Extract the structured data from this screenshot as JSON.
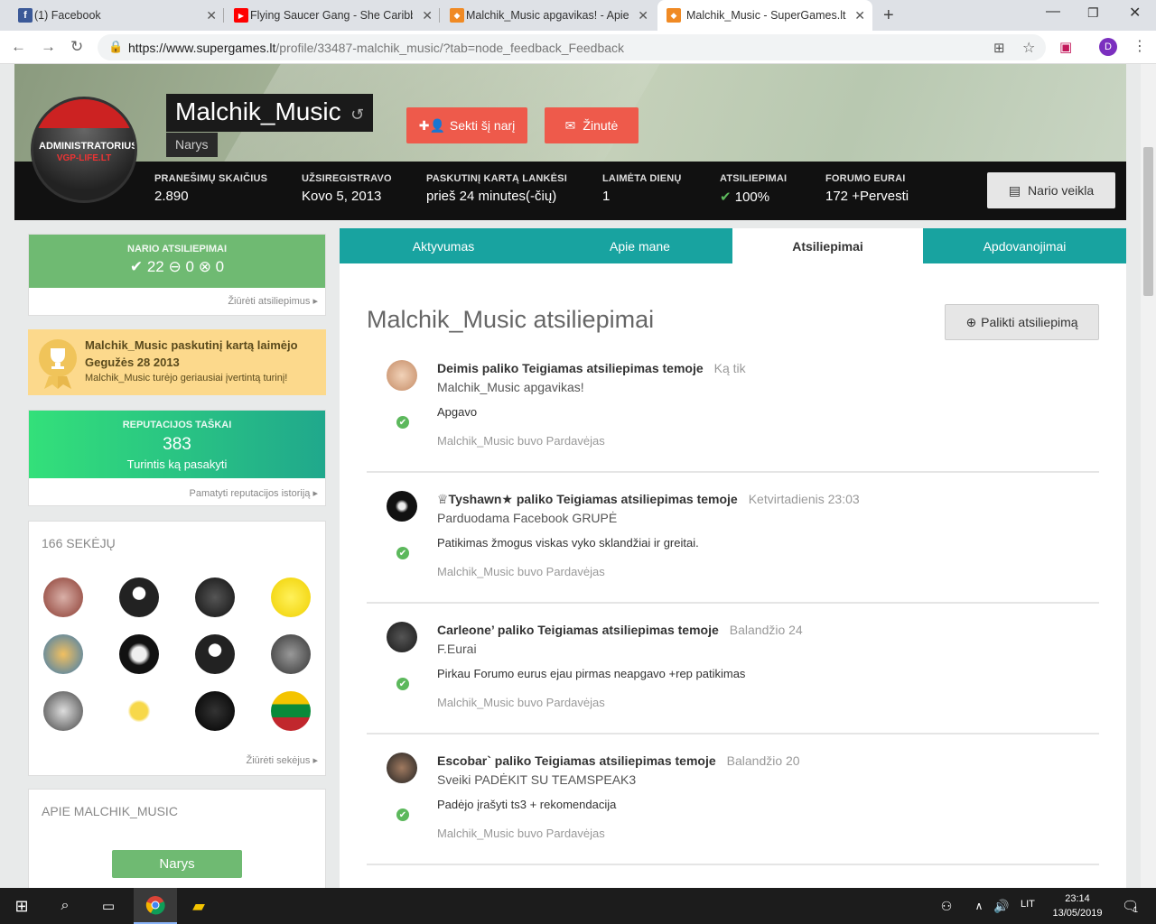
{
  "browser": {
    "tabs": [
      {
        "title": "(1) Facebook",
        "fav_color": "#3b5998",
        "fav_glyph": "f"
      },
      {
        "title": "Flying Saucer Gang - She Caribbe",
        "fav_color": "#ff0000",
        "fav_glyph": "▶"
      },
      {
        "title": "Malchik_Music apgavikas! - Apie",
        "fav_color": "#f08a24",
        "fav_glyph": "◆"
      },
      {
        "title": "Malchik_Music - SuperGames.lt -",
        "fav_color": "#f08a24",
        "fav_glyph": "◆"
      }
    ],
    "new_tab_glyph": "+",
    "url_host": "https://www.supergames.lt",
    "url_path": "/profile/33487-malchik_music/?tab=node_feedback_Feedback",
    "profile_initial": "D"
  },
  "profile": {
    "avatar_line1": "ADMINISTRATORIUS",
    "avatar_line2": "VGP-LIFE.LT",
    "name": "Malchik_Music",
    "role": "Narys",
    "follow_label": "Sekti šį narį",
    "message_label": "Žinutė",
    "activity_label": "Nario veikla",
    "stats": [
      {
        "label": "PRANEŠIMŲ SKAIČIUS",
        "value": "2.890"
      },
      {
        "label": "UŽSIREGISTRAVO",
        "value": "Kovo 5, 2013"
      },
      {
        "label": "PASKUTINĮ KARTĄ LANKĖSI",
        "value": "prieš 24 minutes(-čių)"
      },
      {
        "label": "LAIMĖTA DIENŲ",
        "value": "1"
      },
      {
        "label": "ATSILIEPIMAI",
        "value": "100%"
      },
      {
        "label": "FORUMO EURAI",
        "value": "172 +Pervesti"
      }
    ]
  },
  "sidebar": {
    "feedback_label": "NARIO ATSILIEPIMAI",
    "feedback_pos": "22",
    "feedback_neu": "0",
    "feedback_neg": "0",
    "feedback_link": "Žiūrėti atsiliepimus",
    "win_title": "Malchik_Music paskutinį kartą laimėjo",
    "win_date": "Gegužės 28 2013",
    "win_desc": "Malchik_Music turėjo geriausiai įvertintą turinį!",
    "rep_label": "REPUTACIJOS TAŠKAI",
    "rep_value": "383",
    "rep_sub": "Turintis ką pasakyti",
    "rep_link": "Pamatyti reputacijos istoriją",
    "followers_title": "166 SEKĖJŲ",
    "followers_link": "Žiūrėti sekėjus",
    "about_title": "APIE MALCHIK_MUSIC",
    "about_role": "Narys"
  },
  "main": {
    "tabs": [
      "Aktyvumas",
      "Apie mane",
      "Atsiliepimai",
      "Apdovanojimai"
    ],
    "active_tab": "Atsiliepimai",
    "title": "Malchik_Music atsiliepimai",
    "leave_label": "Palikti atsiliepimą",
    "feedback": [
      {
        "head": "Deimis paliko Teigiamas atsiliepimas temoje",
        "time": "Ką tik",
        "topic": "Malchik_Music apgavikas!",
        "text": "Apgavo",
        "role": "Malchik_Music buvo Pardavėjas"
      },
      {
        "head": "♕Tyshawn★ paliko Teigiamas atsiliepimas temoje",
        "time": "Ketvirtadienis 23:03",
        "topic": "Parduodama Facebook GRUPĖ",
        "text": "Patikimas žmogus viskas vyko sklandžiai ir greitai.",
        "role": "Malchik_Music buvo Pardavėjas"
      },
      {
        "head": "Carleone’ paliko Teigiamas atsiliepimas temoje",
        "time": "Balandžio 24",
        "topic": "F.Eurai",
        "text": "Pirkau Forumo eurus ejau pirmas neapgavo +rep patikimas",
        "role": "Malchik_Music buvo Pardavėjas"
      },
      {
        "head": "Escobar` paliko Teigiamas atsiliepimas temoje",
        "time": "Balandžio 20",
        "topic": "Sveiki PADĖKIT SU TEAMSPEAK3",
        "text": "Padėjo įrašyti ts3 + rekomendacija",
        "role": "Malchik_Music buvo Pardavėjas"
      }
    ]
  },
  "taskbar": {
    "lang": "LIT",
    "time": "23:14",
    "date": "13/05/2019",
    "notif_count": "1"
  },
  "colors": {
    "accent_teal": "#18a3a0",
    "button_red": "#ee5a4b",
    "success_green": "#6fba72"
  }
}
